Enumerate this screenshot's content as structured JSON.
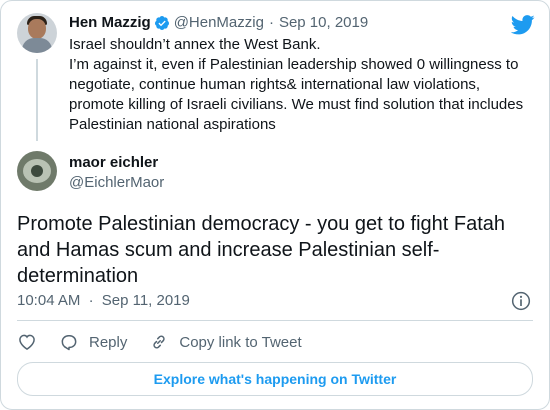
{
  "parent_tweet": {
    "name": "Hen Mazzig",
    "handle": "@HenMazzig",
    "separator": "·",
    "date": "Sep 10, 2019",
    "text_lines": [
      "Israel shouldn’t annex the West Bank.",
      "I’m against it, even if Palestinian leadership showed 0 willingness to",
      "negotiate, continue human rights& international law violations,",
      "promote killing of Israeli civilians. We must find solution that includes",
      "Palestinian national aspirations"
    ]
  },
  "reply_tweet": {
    "name": "maor eichler",
    "handle": "@EichlerMaor",
    "text_lines": [
      "Promote Palestinian democracy - you get to fight Fatah",
      "and Hamas scum and increase Palestinian self-",
      "determination"
    ],
    "time": "10:04 AM",
    "separator": "·",
    "date": "Sep 11, 2019"
  },
  "actions": {
    "reply_label": "Reply",
    "copy_link_label": "Copy link to Tweet"
  },
  "explore_label": "Explore what's happening on Twitter",
  "icons": {
    "like": "heart-icon",
    "reply": "reply-bubble-icon",
    "copy": "link-icon",
    "info": "info-icon",
    "verified": "verified-badge-icon",
    "brand": "twitter-bird-icon"
  },
  "colors": {
    "accent": "#1d9bf0",
    "text": "#0f1419",
    "secondary": "#536471",
    "border": "#cfd9de"
  }
}
